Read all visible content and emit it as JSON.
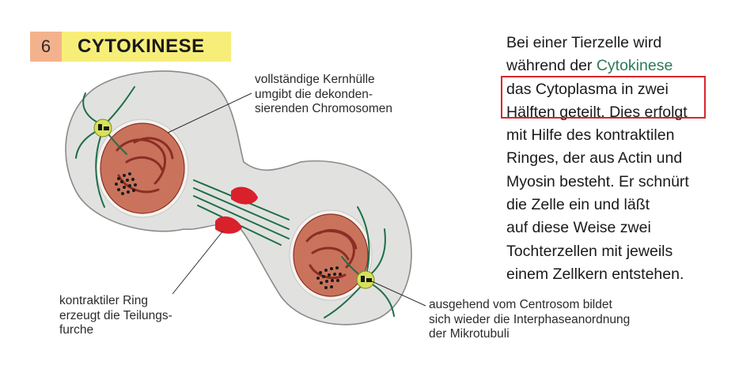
{
  "heading": {
    "number": "6",
    "title": "CYTOKINESE"
  },
  "description": {
    "line1": "Bei einer Tierzelle wird",
    "line2_prefix": "während der ",
    "line2_highlight": "Cytokinese",
    "line3": "das Cytoplasma in zwei",
    "line4_part1": "Hälften geteilt.",
    "line4_part2": " Dies erfolgt",
    "line5": "mit Hilfe des kontraktilen",
    "line6": "Ringes, der aus Actin und",
    "line7": "Myosin besteht. Er schnürt",
    "line8": "die Zelle ein und läßt",
    "line9": "auf diese Weise zwei",
    "line10": "Tochterzellen mit jeweils",
    "line11": "einem Zellkern entstehen."
  },
  "labels": {
    "nuclear_envelope": [
      "vollständige Kernhülle",
      "umgibt die dekonden-",
      "sierenden Chromosomen"
    ],
    "contractile_ring": [
      "kontraktiler Ring",
      "erzeugt die Teilungs-",
      "furche"
    ],
    "centrosome": [
      "ausgehend vom Centrosom bildet",
      "sich wieder die Interphaseanordnung",
      "der Mikrotubuli"
    ]
  },
  "colors": {
    "cell": "#e1e2df",
    "cell_outline": "#8a8a8a",
    "nucleus_envelope": "#f4f2ee",
    "nucleus": "#c9735c",
    "chromosome": "#8b2e24",
    "microtubule": "#1f6e4a",
    "centrosome": "#d6e25a",
    "contractile_ring": "#d8212a",
    "highlight_frame": "#d9262d"
  }
}
